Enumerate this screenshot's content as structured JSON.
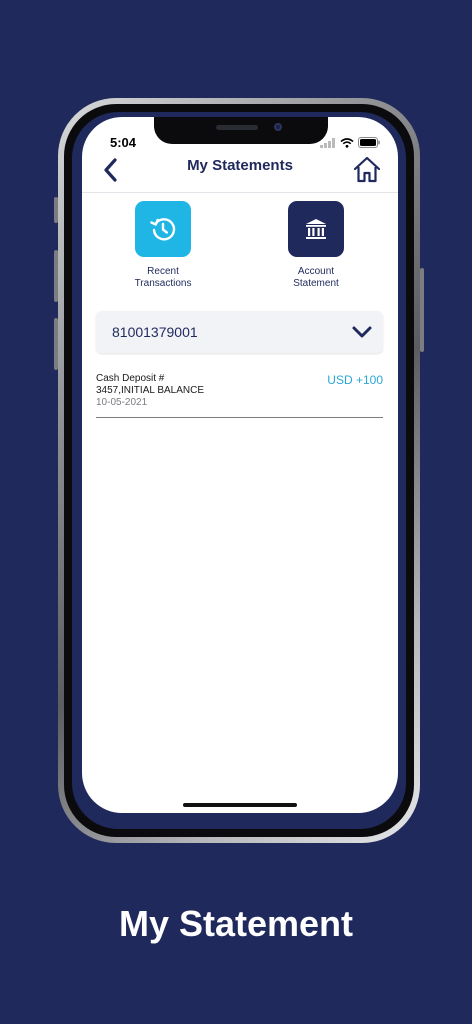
{
  "status_bar": {
    "time": "5:04"
  },
  "header": {
    "title": "My Statements"
  },
  "actions": [
    {
      "label_line1": "Recent",
      "label_line2": "Transactions",
      "color": "#1fb6e6"
    },
    {
      "label_line1": "Account",
      "label_line2": "Statement",
      "color": "#1f295c"
    }
  ],
  "account_select": {
    "value": "81001379001"
  },
  "transactions": [
    {
      "line1": "Cash Deposit  #",
      "line2": "3457,INITIAL BALANCE",
      "date": "10-05-2021",
      "amount": "USD +100"
    }
  ],
  "caption": "My Statement",
  "colors": {
    "background": "#1f295c",
    "accent": "#1fb6e6",
    "amount": "#2ba7d6"
  }
}
